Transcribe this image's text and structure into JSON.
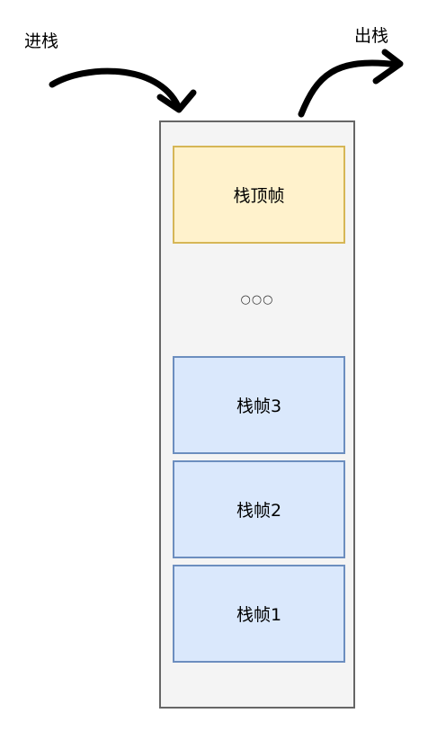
{
  "labels": {
    "push": "进栈",
    "pop": "出栈"
  },
  "stack": {
    "top_frame": "栈顶帧",
    "ellipsis": "○○○",
    "frames": [
      "栈帧3",
      "栈帧2",
      "栈帧1"
    ]
  },
  "colors": {
    "top_frame_fill": "#fff2cc",
    "top_frame_border": "#d6b656",
    "frame_fill": "#dae8fc",
    "frame_border": "#6c8ebf",
    "container_fill": "#f4f4f4",
    "container_border": "#666666",
    "arrow": "#000000"
  },
  "icons": {
    "push_arrow": "curved-arrow-down-icon",
    "pop_arrow": "curved-arrow-up-icon"
  }
}
